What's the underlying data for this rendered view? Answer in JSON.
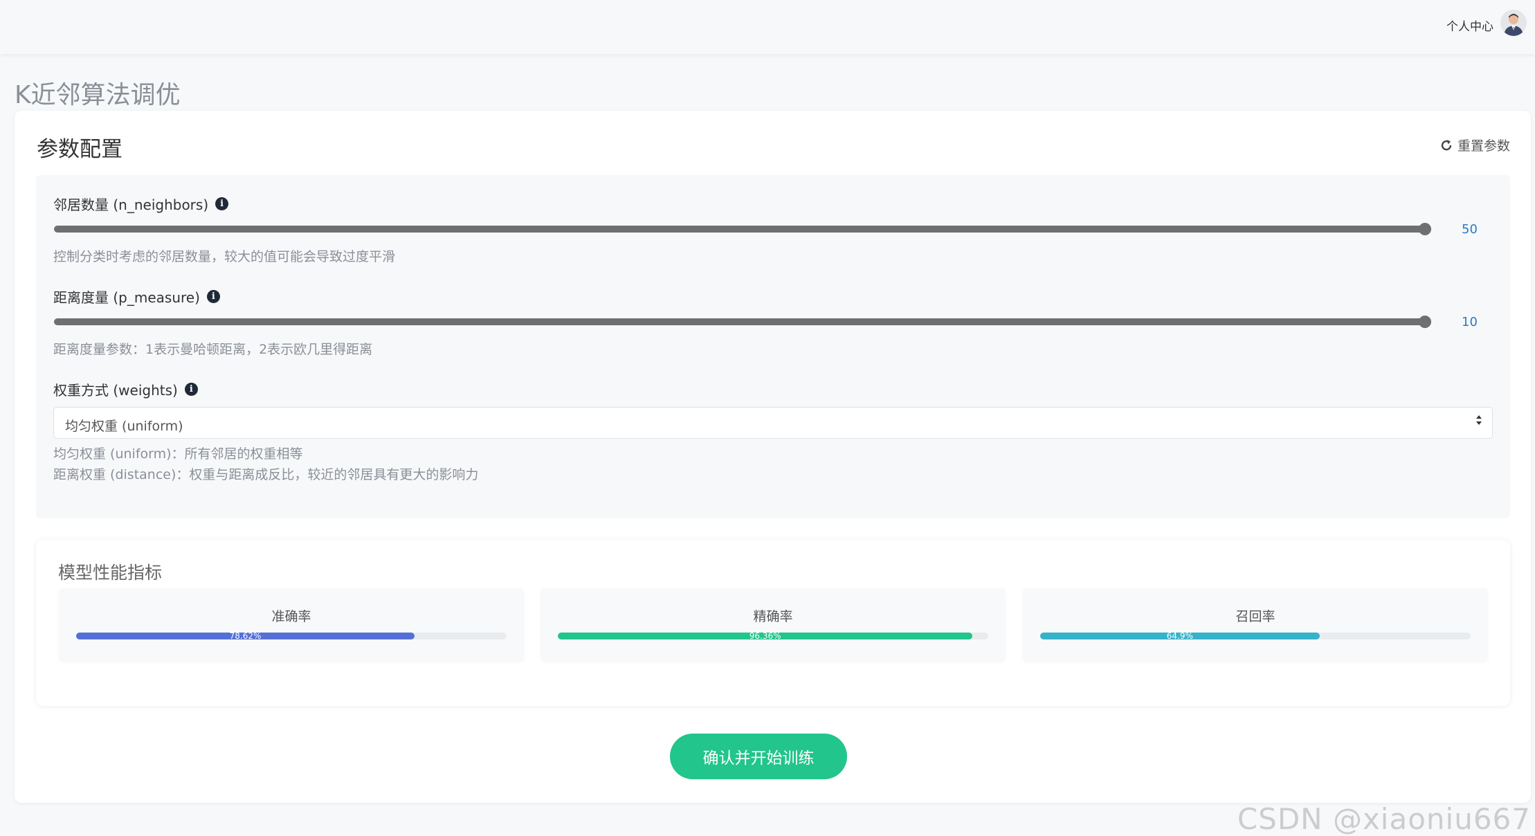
{
  "header": {
    "user_center": "个人中心"
  },
  "page": {
    "title": "K近邻算法调优"
  },
  "config": {
    "title": "参数配置",
    "reset_label": "重置参数",
    "params": [
      {
        "label": "邻居数量 (n_neighbors)",
        "value": "50",
        "fraction": 1.0,
        "hint": "控制分类时考虑的邻居数量，较大的值可能会导致过度平滑"
      },
      {
        "label": "距离度量 (p_measure)",
        "value": "10",
        "fraction": 1.0,
        "hint": "距离度量参数：1表示曼哈顿距离，2表示欧几里得距离"
      }
    ],
    "weights": {
      "label": "权重方式 (weights)",
      "selected": "均匀权重 (uniform)",
      "hint1": "均匀权重 (uniform)：所有邻居的权重相等",
      "hint2": "距离权重 (distance)：权重与距离成反比，较近的邻居具有更大的影响力"
    }
  },
  "metrics": {
    "title": "模型性能指标",
    "items": [
      {
        "label": "准确率",
        "percent": 78.62,
        "text": "78.62%",
        "color": "#5470d6"
      },
      {
        "label": "精确率",
        "percent": 96.36,
        "text": "96.36%",
        "color": "#22c58b"
      },
      {
        "label": "召回率",
        "percent": 64.9,
        "text": "64.9%",
        "color": "#36b3c9"
      }
    ]
  },
  "actions": {
    "confirm_label": "确认并开始训练"
  },
  "watermark": "CSDN @xiaoniu667",
  "icons": {
    "info": "info-icon",
    "reset": "refresh-icon",
    "avatar": "avatar",
    "caret": "sort-caret-icon"
  }
}
